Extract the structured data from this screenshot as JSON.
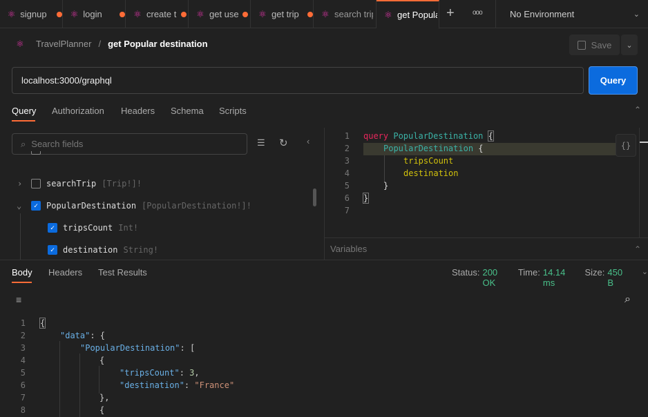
{
  "tabs": [
    {
      "label": "signup",
      "unsaved": true
    },
    {
      "label": "login",
      "unsaved": true
    },
    {
      "label": "create t",
      "unsaved": true
    },
    {
      "label": "get use",
      "unsaved": true
    },
    {
      "label": "get trip",
      "unsaved": true
    },
    {
      "label": "search trip",
      "unsaved": false
    },
    {
      "label": "get Popular destination",
      "unsaved": false,
      "active": true
    }
  ],
  "environment": "No Environment",
  "breadcrumb": {
    "collection": "TravelPlanner",
    "separator": "/",
    "request": "get Popular destination"
  },
  "save_label": "Save",
  "url": "localhost:3000/graphql",
  "query_button": "Query",
  "request_tabs": [
    "Query",
    "Authorization",
    "Headers",
    "Schema",
    "Scripts"
  ],
  "search_placeholder": "Search fields",
  "schema_fields": [
    {
      "name": "searchTrip",
      "type": "[Trip!]!",
      "checked": false,
      "expanded": false
    },
    {
      "name": "PopularDestination",
      "type": "[PopularDestination!]!",
      "checked": true,
      "expanded": true,
      "children": [
        {
          "name": "tripsCount",
          "type": "Int!",
          "checked": true
        },
        {
          "name": "destination",
          "type": "String!",
          "checked": true
        }
      ]
    }
  ],
  "query_lines": [
    "1",
    "2",
    "3",
    "4",
    "5",
    "6",
    "7"
  ],
  "query_code": {
    "keyword": "query",
    "op_name": "PopularDestination",
    "field": "PopularDestination",
    "sub1": "tripsCount",
    "sub2": "destination"
  },
  "variables_label": "Variables",
  "response_tabs": [
    "Body",
    "Headers",
    "Test Results"
  ],
  "status": {
    "status_label": "Status:",
    "status": "200 OK",
    "time_label": "Time:",
    "time": "14.14 ms",
    "size_label": "Size:",
    "size": "450 B",
    "color": "#49c08a"
  },
  "response_lines": [
    "1",
    "2",
    "3",
    "4",
    "5",
    "6",
    "7",
    "8"
  ],
  "response": {
    "data_key": "\"data\"",
    "pd_key": "\"PopularDestination\"",
    "tc_key": "\"tripsCount\"",
    "tc_val": "3",
    "dest_key": "\"destination\"",
    "dest_val": "\"France\""
  },
  "colors": {
    "accent": "#ff6c37",
    "primary": "#0b6bde",
    "graphql": "#e535ab"
  }
}
